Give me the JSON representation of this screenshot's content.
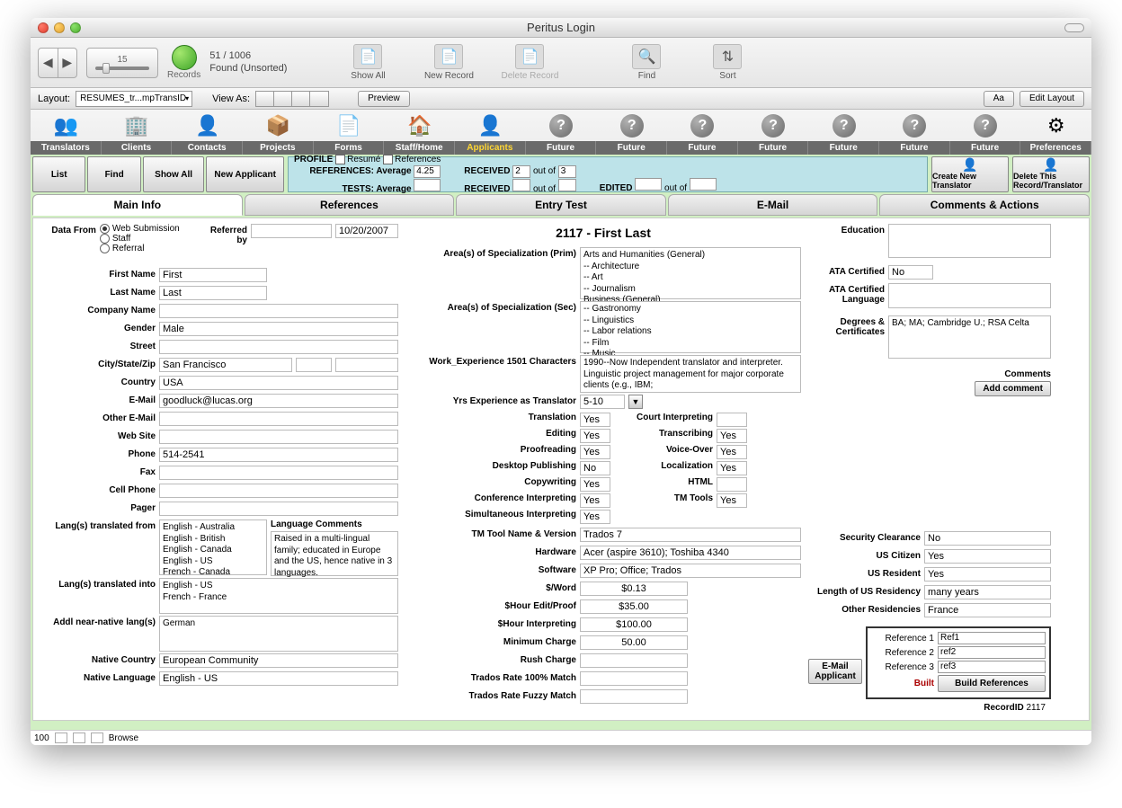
{
  "title": "Peritus Login",
  "toolbar1": {
    "page": "15",
    "count": "51 / 1006",
    "found": "Found (Unsorted)",
    "records_label": "Records",
    "show_all": "Show All",
    "new_record": "New Record",
    "delete_record": "Delete Record",
    "find": "Find",
    "sort": "Sort"
  },
  "toolbar2": {
    "layout_label": "Layout:",
    "layout_value": "RESUMES_tr...mpTransID",
    "view_as": "View As:",
    "preview": "Preview",
    "edit_layout": "Edit Layout",
    "aa": "Aa"
  },
  "icontabs": [
    "Translators",
    "Clients",
    "Contacts",
    "Projects",
    "Forms",
    "Staff/Home",
    "Applicants",
    "Future",
    "Future",
    "Future",
    "Future",
    "Future",
    "Future",
    "Future",
    "Preferences"
  ],
  "icontab_active": 6,
  "strip": {
    "list": "List",
    "find": "Find",
    "show_all": "Show All",
    "new_applicant": "New Applicant",
    "profile": "PROFILE",
    "resume": "Resumé",
    "references": "References",
    "refs_avg": "REFERENCES: Average",
    "refs_avg_val": "4.25",
    "tests_avg": "TESTS: Average",
    "tests_avg_val": "",
    "received1": "RECEIVED",
    "received1_val": "2",
    "outof1": "out of",
    "outof1_val": "3",
    "received2": "RECEIVED",
    "received2_val": "",
    "outof2": "out of",
    "outof2_val": "",
    "edited": "EDITED",
    "edited_val": "",
    "outof3": "out of",
    "outof3_val": "",
    "create_new": "Create New Translator",
    "delete_this": "Delete This Record/Translator"
  },
  "tabs5": [
    "Main Info",
    "References",
    "Entry Test",
    "E-Mail",
    "Comments & Actions"
  ],
  "active_tab5": 0,
  "record_heading": "2117 - First Last",
  "left": {
    "data_from_label": "Data From",
    "data_from_opts": [
      "Web Submission",
      "Staff",
      "Referral"
    ],
    "data_from_sel": 0,
    "referred_by_label": "Referred by",
    "referred_by": "",
    "referred_date": "10/20/2007",
    "first_name_label": "First Name",
    "first_name": "First",
    "last_name_label": "Last Name",
    "last_name": "Last",
    "company_label": "Company Name",
    "company": "",
    "gender_label": "Gender",
    "gender": "Male",
    "street_label": "Street",
    "street": "",
    "csz_label": "City/State/Zip",
    "city": "San Francisco",
    "state": "",
    "zip": "",
    "country_label": "Country",
    "country": "USA",
    "email_label": "E-Mail",
    "email": "goodluck@lucas.org",
    "other_email_label": "Other E-Mail",
    "other_email": "",
    "website_label": "Web Site",
    "website": "",
    "phone_label": "Phone",
    "phone": "514-2541",
    "fax_label": "Fax",
    "fax": "",
    "cell_label": "Cell Phone",
    "cell": "",
    "pager_label": "Pager",
    "pager": "",
    "langs_from_label": "Lang(s) translated from",
    "langs_from": "English - Australia\nEnglish - British\nEnglish - Canada\nEnglish - US\nFrench - Canada",
    "lang_comments_label": "Language Comments",
    "lang_comments": "Raised in a multi-lingual family; educated in Europe and the US, hence native in 3 languages.",
    "langs_into_label": "Lang(s) translated into",
    "langs_into": "English - US\nFrench - France",
    "addl_label": "Addl near-native lang(s)",
    "addl": "German",
    "native_country_label": "Native Country",
    "native_country": "European Community",
    "native_lang_label": "Native Language",
    "native_lang": "English - US"
  },
  "mid": {
    "spec_prim_label": "Area(s) of Specialization (Prim)",
    "spec_prim": "Arts and Humanities (General)\n-- Architecture\n-- Art\n-- Journalism\nBusiness (General)",
    "spec_sec_label": "Area(s) of Specialization (Sec)",
    "spec_sec": "-- Gastronomy\n-- Linguistics\n-- Labor relations\n-- Film\n-- Music",
    "work_exp_label": "Work_Experience 1501 Characters",
    "work_exp": "1990--Now   Independent translator and interpreter. Linguistic project management for major corporate clients (e.g., IBM;",
    "yrs_label": "Yrs Experience as Translator",
    "yrs": "5-10",
    "skills": [
      {
        "l": "Translation",
        "v": "Yes",
        "l2": "Court Interpreting",
        "v2": ""
      },
      {
        "l": "Editing",
        "v": "Yes",
        "l2": "Transcribing",
        "v2": "Yes"
      },
      {
        "l": "Proofreading",
        "v": "Yes",
        "l2": "Voice-Over",
        "v2": "Yes"
      },
      {
        "l": "Desktop Publishing",
        "v": "No",
        "l2": "Localization",
        "v2": "Yes"
      },
      {
        "l": "Copywriting",
        "v": "Yes",
        "l2": "HTML",
        "v2": ""
      },
      {
        "l": "Conference Interpreting",
        "v": "Yes",
        "l2": "TM Tools",
        "v2": "Yes"
      },
      {
        "l": "Simultaneous Interpreting",
        "v": "Yes",
        "l2": "",
        "v2": ""
      }
    ],
    "tm_label": "TM Tool Name & Version",
    "tm": "Trados 7",
    "hw_label": "Hardware",
    "hw": "Acer (aspire 3610); Toshiba 4340",
    "sw_label": "Software",
    "sw": "XP Pro; Office; Trados",
    "pw_label": "$/Word",
    "pw": "$0.13",
    "ph_ep_label": "$Hour Edit/Proof",
    "ph_ep": "$35.00",
    "ph_int_label": "$Hour Interpreting",
    "ph_int": "$100.00",
    "min_label": "Minimum Charge",
    "min": "50.00",
    "rush_label": "Rush Charge",
    "rush": "",
    "t100_label": "Trados Rate 100% Match",
    "t100": "",
    "tfuz_label": "Trados Rate Fuzzy Match",
    "tfuz": ""
  },
  "right": {
    "edu_label": "Education",
    "edu": "",
    "ata_cert_label": "ATA Certified",
    "ata_cert": "No",
    "ata_lang_label": "ATA Certified Language",
    "ata_lang": "",
    "deg_label": "Degrees & Certificates",
    "deg": "BA; MA; Cambridge U.; RSA Celta",
    "comments_label": "Comments",
    "add_comment": "Add comment",
    "sec_label": "Security Clearance",
    "sec": "No",
    "usc_label": "US Citizen",
    "usc": "Yes",
    "usr_label": "US Resident",
    "usr": "Yes",
    "lor_label": "Length of US Residency",
    "lor": "many years",
    "or_label": "Other Residencies",
    "or": "France",
    "email_app": "E-Mail Applicant",
    "refs": [
      {
        "l": "Reference 1",
        "v": "Ref1"
      },
      {
        "l": "Reference 2",
        "v": "ref2"
      },
      {
        "l": "Reference 3",
        "v": "ref3"
      }
    ],
    "built": "Built",
    "build_refs": "Build References",
    "recordid_label": "RecordID",
    "recordid": "2117"
  },
  "footer": {
    "zoom": "100",
    "mode": "Browse"
  }
}
